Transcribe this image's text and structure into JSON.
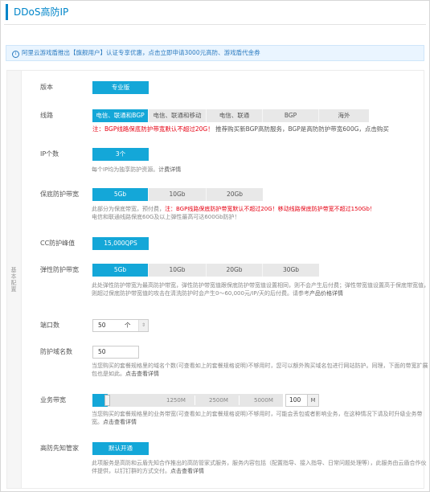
{
  "header": {
    "title": "DDoS高防IP"
  },
  "notice": {
    "icon": "info-icon",
    "text": "阿里云游戏盾推出【旗舰用户】认证专享优惠，点击立即申请3000元高防、游戏盾代金券"
  },
  "config": {
    "side_label": "基本配置",
    "version": {
      "label": "版本",
      "value": "专业版"
    },
    "line": {
      "label": "线路",
      "options": [
        "电信、联通和BGP",
        "电信、联通和移动",
        "电信、联通",
        "BGP",
        "海外"
      ],
      "selected_index": 0,
      "note_red": "注：BGP线路保底防护带宽默认不超过20G！",
      "note_rest": "推荐购买新BGP高防服务，BGP是高防防护带宽600G，点击购买"
    },
    "ip_count": {
      "label": "IP个数",
      "value": "3个",
      "note": "每个IP均为独享防护资源。",
      "note_link": "计费详情"
    },
    "base_bw": {
      "label": "保底防护带宽",
      "options": [
        "5Gb",
        "10Gb",
        "20Gb"
      ],
      "selected_index": 0,
      "note_1": "此部分为保底带宽，预付费，",
      "note_red": "注：BGP线路保底防护带宽默认不超过20G！移动线路保底防护带宽不超过150Gb！",
      "note_2": "电信和联通线路保底60G及以上弹性最高可达600Gb防护！"
    },
    "cc_peak": {
      "label": "CC防护峰值",
      "value": "15,000QPS"
    },
    "elastic_bw": {
      "label": "弹性防护带宽",
      "options": [
        "5Gb",
        "10Gb",
        "20Gb",
        "30Gb"
      ],
      "selected_index": 0,
      "note_1": "此处弹性防护带宽为最高防护带宽，弹性防护带宽值跟保底防护带宽值设置相同，则不会产生后付费；弹性带宽值设置高于保底带宽值，则超过保底防护带宽值的攻击在清洗防护时会产生0～60,000元/IP/天的后付费。请参考",
      "note_link": "产品价格详情"
    },
    "ports": {
      "label": "端口数",
      "value": "50",
      "unit": "个"
    },
    "domains": {
      "label": "防护域名数",
      "value": "50",
      "note_1": "当您购买的套餐规格里的域名个数(可查看如上的套餐规格说明)不够用时，您可以额外购买域名包进行网站防护。同理，下面的带宽扩展包也是如此。",
      "note_link": "点击查看详情"
    },
    "bandwidth": {
      "label": "业务带宽",
      "marks": [
        "1250M",
        "2500M",
        "5000M"
      ],
      "value": "100",
      "unit": "M",
      "fill_fraction": 0.08,
      "note_1": "当您购买的套餐规格里的业务带宽(可查看如上的套餐规格说明)不够用时，可能会丢包或者影响业务，在这种情况下请及时升级业务带宽。",
      "note_link": "点击查看详情"
    },
    "manager": {
      "label": "高防先知管家",
      "button": "默认开通",
      "note_1": "此项服务是高防和云盾先知合作推出的高防管家式服务，服务内容包括（配置指导、接入指导、日常问题处理等），此服务由云盾合作伙伴提供，以钉钉群的方式交付。",
      "note_link": "点击查看详情"
    }
  }
}
